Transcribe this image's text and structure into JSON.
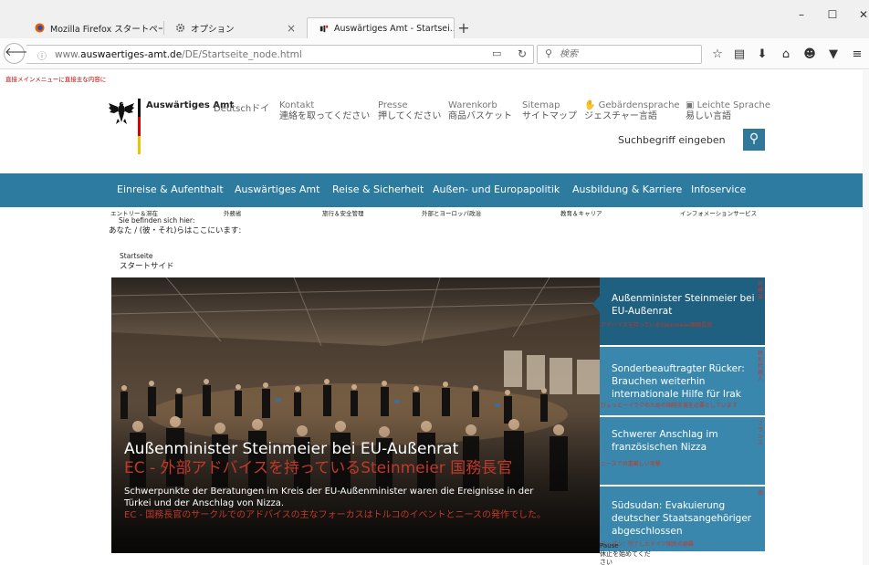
{
  "browser": {
    "tabs": [
      {
        "label": "Mozilla Firefox スタートページ"
      },
      {
        "label": "オプション"
      },
      {
        "label": "Auswärtiges Amt - Startsei..."
      }
    ],
    "url_prefix": "www.",
    "url_domain": "auswaertiges-amt.de",
    "url_path": "/DE/Startseite_node.html",
    "search_placeholder": "検索",
    "window_controls": {
      "minimize": "–",
      "maximize": "☐",
      "close": "✕"
    }
  },
  "page": {
    "skip_links": "直接メインメニューに直接主な内容に",
    "brand": "Auswärtiges Amt",
    "language": "Deutschドイ",
    "header_links": [
      {
        "label": "Kontakt",
        "sub": "連絡を取ってください"
      },
      {
        "label": "Presse",
        "sub": "押してください"
      },
      {
        "label": "Warenkorb",
        "sub": "商品バスケット"
      },
      {
        "label": "Sitemap",
        "sub": "サイトマップ"
      },
      {
        "label": "Gebärdensprache",
        "sub": "ジェスチャー言語"
      },
      {
        "label": "Leichte Sprache",
        "sub": "易しい言語"
      }
    ],
    "site_search_value": "Suchbegriff eingeben",
    "nav": [
      {
        "label": "Einreise & Aufenthalt",
        "sub": "エントリー＆滞在"
      },
      {
        "label": "Auswärtiges Amt",
        "sub": "外務省"
      },
      {
        "label": "Reise & Sicherheit",
        "sub": "旅行＆安全管理"
      },
      {
        "label": "Außen- und Europapolitik",
        "sub": "外部とヨーロッパ政治"
      },
      {
        "label": "Ausbildung & Karriere",
        "sub": "教育＆キャリア"
      },
      {
        "label": "Infoservice",
        "sub": "インフォメーションサービス"
      }
    ],
    "breadcrumb": {
      "label_de": "Sie befinden sich hier:",
      "label_jp": "あなた / (彼・それ)らはここにいます:",
      "current_de": "Startseite",
      "current_jp": "スタートサイド"
    },
    "hero": {
      "title": "Außenminister Steinmeier bei EU-Außenrat",
      "title_jp": "EC - 外部アドバイスを持っているSteinmeier 国務長官",
      "body": "Schwerpunkte der Beratungen im Kreis der EU-Außenminister waren die Ereignisse in der Türkei und der Anschlag von Nizza.",
      "body_jp": "EC - 国務長官のサークルでのアドバイスの主なフォーカスはトルコのイベントとニースの発作でした。"
    },
    "news": [
      {
        "title": "Außenminister Steinmeier bei EU-Außenrat",
        "sub": "アドバイスを持っているSteinmeier国務長官",
        "vert": "外務省"
      },
      {
        "title": "Sonderbeauftragter Rücker: Brauchen weiterhin internationale Hilfe für Irak",
        "sub": "ひょっとーイラクのための国際支援を必要としています",
        "vert": "特別代理人"
      },
      {
        "title": "Schwerer Anschlag im französischen Nizza",
        "sub": "ニースでの重厳しい攻撃",
        "vert": "フランス"
      },
      {
        "title": "Südsudan: Evakuierung deutscher Staatsangehöriger abgeschlossen",
        "sub": "スーダン：完了したドイツ国民の避難",
        "vert": "南"
      }
    ],
    "pause": {
      "de": "Pause",
      "jp": "休止を始めてください"
    }
  },
  "colors": {
    "nav_bg": "#2e7ba0",
    "news_active": "#1f5f80",
    "news_item": "#3a87ad",
    "accent_red": "#c0392b"
  }
}
